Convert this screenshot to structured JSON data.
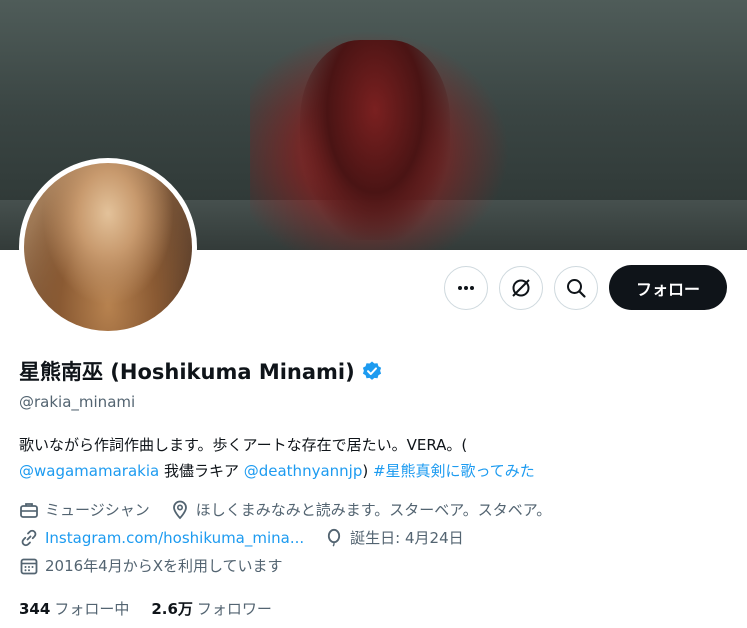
{
  "profile": {
    "name": "星熊南巫 (Hoshikuma Minami)",
    "handle": "@rakia_minami",
    "bio": {
      "line1": "歌いながら作詞作曲します。歩くアートな存在で居たい。VERA。(",
      "mention1": "@wagamamarakia",
      "mid_text": " 我儘ラキア ",
      "mention2": "@deathnyannjp",
      "close_paren": ") ",
      "hashtag": "#星熊真剣に歌ってみた"
    },
    "category": "ミュージシャン",
    "location": "ほしくまみなみと読みます。スターベア。スタベア。",
    "website": "Instagram.com/hoshikuma_mina...",
    "birthday": "誕生日: 4月24日",
    "joined": "2016年4月からXを利用しています",
    "following_count": "344",
    "following_label": "フォロー中",
    "followers_count": "2.6万",
    "followers_label": "フォロワー"
  },
  "actions": {
    "follow_label": "フォロー"
  },
  "colors": {
    "link": "#1d9bf0",
    "follow_button": "#0f1419",
    "secondary_text": "#536471"
  },
  "icons": [
    "more-icon",
    "grok-icon",
    "search-icon",
    "verified-badge-icon",
    "briefcase-icon",
    "location-pin-icon",
    "link-icon",
    "balloon-icon",
    "calendar-icon"
  ]
}
